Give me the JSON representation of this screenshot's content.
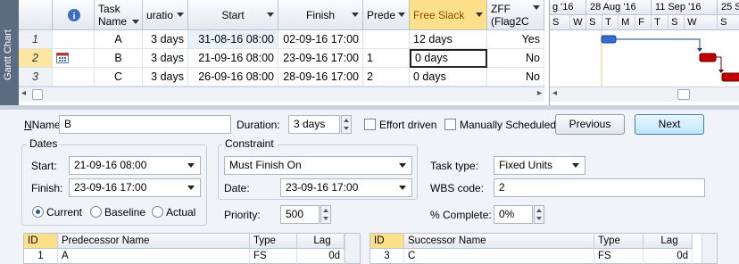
{
  "sidebar": {
    "label": "Gantt Chart"
  },
  "grid": {
    "headers": {
      "info": "i",
      "task_name": "Task Name",
      "duration": "uratio",
      "start": "Start",
      "finish": "Finish",
      "predecessors": "Prede",
      "free_slack": "Free Slack",
      "zff": "ZFF (Flag2C"
    },
    "rows": [
      {
        "id": "1",
        "name": "A",
        "duration": "3 days",
        "start": "31-08-16 08:00",
        "finish": "02-09-16 17:00",
        "pred": "",
        "free_slack": "12 days",
        "zff": "Yes"
      },
      {
        "id": "2",
        "name": "B",
        "duration": "3 days",
        "start": "21-09-16 08:00",
        "finish": "23-09-16 17:00",
        "pred": "1",
        "free_slack": "0 days",
        "zff": "No"
      },
      {
        "id": "3",
        "name": "C",
        "duration": "3 days",
        "start": "26-09-16 08:00",
        "finish": "28-09-16 17:00",
        "pred": "2",
        "free_slack": "0 days",
        "zff": "No"
      }
    ]
  },
  "gantt": {
    "weeks": [
      "g '16",
      "28 Aug '16",
      "11 Sep '16",
      "25 S"
    ],
    "days": [
      "S",
      "W",
      "S",
      "T",
      "M",
      "F",
      "T",
      "S",
      "W",
      "S"
    ]
  },
  "form": {
    "name_label": "Name:",
    "name_value": "B",
    "duration_label": "Duration:",
    "duration_value": "3 days",
    "effort_driven": "Effort driven",
    "manually_scheduled": "Manually Scheduled",
    "previous": "Previous",
    "next": "Next",
    "dates_title": "Dates",
    "start_label": "Start:",
    "start_value": "21-09-16 08:00",
    "finish_label": "Finish:",
    "finish_value": "23-09-16 17:00",
    "current": "Current",
    "baseline": "Baseline",
    "actual": "Actual",
    "constraint_title": "Constraint",
    "constraint_value": "Must Finish On",
    "date_label": "Date:",
    "date_value": "23-09-16 17:00",
    "priority_label": "Priority:",
    "priority_value": "500",
    "task_type_label": "Task type:",
    "task_type_value": "Fixed Units",
    "wbs_label": "WBS code:",
    "wbs_value": "2",
    "complete_label": "% Complete:",
    "complete_value": "0%"
  },
  "pred_table": {
    "headers": [
      "ID",
      "Predecessor Name",
      "Type",
      "Lag"
    ],
    "row": [
      "1",
      "A",
      "FS",
      "0d"
    ]
  },
  "succ_table": {
    "headers": [
      "ID",
      "Successor Name",
      "Type",
      "Lag"
    ],
    "row": [
      "3",
      "C",
      "FS",
      "0d"
    ]
  },
  "colors": {
    "accent": "#1e5aa8",
    "bar": "#c00000",
    "summary_bar": "#2e6fd0",
    "highlight": "#ffe08a"
  }
}
